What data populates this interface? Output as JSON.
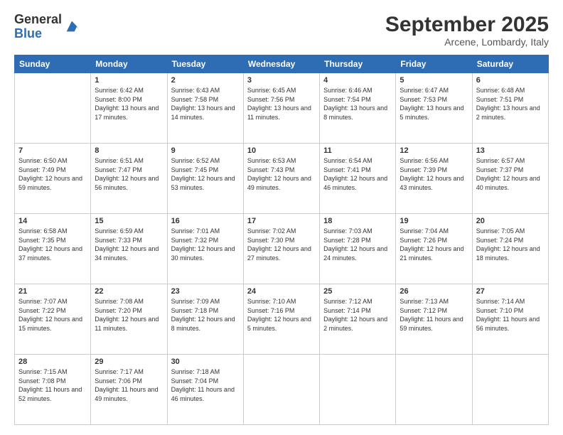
{
  "logo": {
    "general": "General",
    "blue": "Blue"
  },
  "header": {
    "month": "September 2025",
    "location": "Arcene, Lombardy, Italy"
  },
  "weekdays": [
    "Sunday",
    "Monday",
    "Tuesday",
    "Wednesday",
    "Thursday",
    "Friday",
    "Saturday"
  ],
  "weeks": [
    [
      {
        "day": null
      },
      {
        "day": 1,
        "sunrise": "6:42 AM",
        "sunset": "8:00 PM",
        "daylight": "13 hours and 17 minutes."
      },
      {
        "day": 2,
        "sunrise": "6:43 AM",
        "sunset": "7:58 PM",
        "daylight": "13 hours and 14 minutes."
      },
      {
        "day": 3,
        "sunrise": "6:45 AM",
        "sunset": "7:56 PM",
        "daylight": "13 hours and 11 minutes."
      },
      {
        "day": 4,
        "sunrise": "6:46 AM",
        "sunset": "7:54 PM",
        "daylight": "13 hours and 8 minutes."
      },
      {
        "day": 5,
        "sunrise": "6:47 AM",
        "sunset": "7:53 PM",
        "daylight": "13 hours and 5 minutes."
      },
      {
        "day": 6,
        "sunrise": "6:48 AM",
        "sunset": "7:51 PM",
        "daylight": "13 hours and 2 minutes."
      }
    ],
    [
      {
        "day": 7,
        "sunrise": "6:50 AM",
        "sunset": "7:49 PM",
        "daylight": "12 hours and 59 minutes."
      },
      {
        "day": 8,
        "sunrise": "6:51 AM",
        "sunset": "7:47 PM",
        "daylight": "12 hours and 56 minutes."
      },
      {
        "day": 9,
        "sunrise": "6:52 AM",
        "sunset": "7:45 PM",
        "daylight": "12 hours and 53 minutes."
      },
      {
        "day": 10,
        "sunrise": "6:53 AM",
        "sunset": "7:43 PM",
        "daylight": "12 hours and 49 minutes."
      },
      {
        "day": 11,
        "sunrise": "6:54 AM",
        "sunset": "7:41 PM",
        "daylight": "12 hours and 46 minutes."
      },
      {
        "day": 12,
        "sunrise": "6:56 AM",
        "sunset": "7:39 PM",
        "daylight": "12 hours and 43 minutes."
      },
      {
        "day": 13,
        "sunrise": "6:57 AM",
        "sunset": "7:37 PM",
        "daylight": "12 hours and 40 minutes."
      }
    ],
    [
      {
        "day": 14,
        "sunrise": "6:58 AM",
        "sunset": "7:35 PM",
        "daylight": "12 hours and 37 minutes."
      },
      {
        "day": 15,
        "sunrise": "6:59 AM",
        "sunset": "7:33 PM",
        "daylight": "12 hours and 34 minutes."
      },
      {
        "day": 16,
        "sunrise": "7:01 AM",
        "sunset": "7:32 PM",
        "daylight": "12 hours and 30 minutes."
      },
      {
        "day": 17,
        "sunrise": "7:02 AM",
        "sunset": "7:30 PM",
        "daylight": "12 hours and 27 minutes."
      },
      {
        "day": 18,
        "sunrise": "7:03 AM",
        "sunset": "7:28 PM",
        "daylight": "12 hours and 24 minutes."
      },
      {
        "day": 19,
        "sunrise": "7:04 AM",
        "sunset": "7:26 PM",
        "daylight": "12 hours and 21 minutes."
      },
      {
        "day": 20,
        "sunrise": "7:05 AM",
        "sunset": "7:24 PM",
        "daylight": "12 hours and 18 minutes."
      }
    ],
    [
      {
        "day": 21,
        "sunrise": "7:07 AM",
        "sunset": "7:22 PM",
        "daylight": "12 hours and 15 minutes."
      },
      {
        "day": 22,
        "sunrise": "7:08 AM",
        "sunset": "7:20 PM",
        "daylight": "12 hours and 11 minutes."
      },
      {
        "day": 23,
        "sunrise": "7:09 AM",
        "sunset": "7:18 PM",
        "daylight": "12 hours and 8 minutes."
      },
      {
        "day": 24,
        "sunrise": "7:10 AM",
        "sunset": "7:16 PM",
        "daylight": "12 hours and 5 minutes."
      },
      {
        "day": 25,
        "sunrise": "7:12 AM",
        "sunset": "7:14 PM",
        "daylight": "12 hours and 2 minutes."
      },
      {
        "day": 26,
        "sunrise": "7:13 AM",
        "sunset": "7:12 PM",
        "daylight": "11 hours and 59 minutes."
      },
      {
        "day": 27,
        "sunrise": "7:14 AM",
        "sunset": "7:10 PM",
        "daylight": "11 hours and 56 minutes."
      }
    ],
    [
      {
        "day": 28,
        "sunrise": "7:15 AM",
        "sunset": "7:08 PM",
        "daylight": "11 hours and 52 minutes."
      },
      {
        "day": 29,
        "sunrise": "7:17 AM",
        "sunset": "7:06 PM",
        "daylight": "11 hours and 49 minutes."
      },
      {
        "day": 30,
        "sunrise": "7:18 AM",
        "sunset": "7:04 PM",
        "daylight": "11 hours and 46 minutes."
      },
      {
        "day": null
      },
      {
        "day": null
      },
      {
        "day": null
      },
      {
        "day": null
      }
    ]
  ],
  "labels": {
    "sunrise": "Sunrise:",
    "sunset": "Sunset:",
    "daylight": "Daylight:"
  }
}
